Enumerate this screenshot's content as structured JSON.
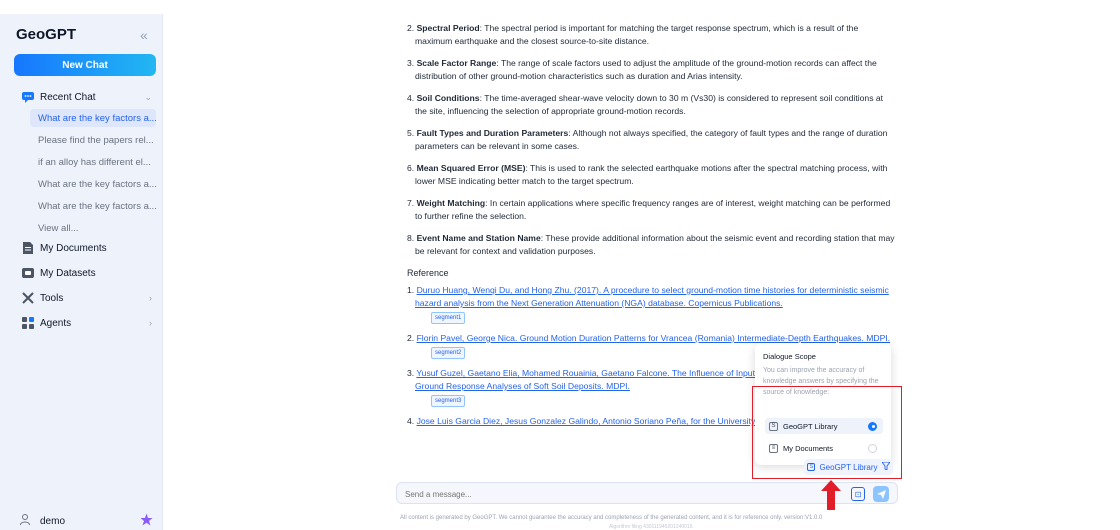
{
  "app": {
    "name": "GeoGPT"
  },
  "sidebar": {
    "new_chat": "New Chat",
    "recent_chat": "Recent Chat",
    "chats": [
      "What are the key factors a...",
      "Please find the papers rel...",
      "if an alloy has different el...",
      "What are the key factors a...",
      "What are the key factors a..."
    ],
    "view_all": "View all...",
    "my_documents": "My Documents",
    "my_datasets": "My Datasets",
    "tools": "Tools",
    "agents": "Agents",
    "user": "demo"
  },
  "answer": {
    "items": [
      {
        "num": "2.",
        "term": "Spectral Period",
        "text": ": The spectral period is important for matching the target response spectrum, which is a result of the maximum earthquake and the closest source-to-site distance."
      },
      {
        "num": "3.",
        "term": "Scale Factor Range",
        "text": ": The range of scale factors used to adjust the amplitude of the ground-motion records can affect the distribution of other ground-motion characteristics such as duration and Arias intensity."
      },
      {
        "num": "4.",
        "term": "Soil Conditions",
        "text": ": The time-averaged shear-wave velocity down to 30 m (Vs30) is considered to represent soil conditions at the site, influencing the selection of appropriate ground-motion records."
      },
      {
        "num": "5.",
        "term": "Fault Types and Duration Parameters",
        "text": ": Although not always specified, the category of fault types and the range of duration parameters can be relevant in some cases."
      },
      {
        "num": "6.",
        "term": "Mean Squared Error (MSE)",
        "text": ": This is used to rank the selected earthquake motions after the spectral matching process, with lower MSE indicating better match to the target spectrum."
      },
      {
        "num": "7.",
        "term": "Weight Matching",
        "text": ": In certain applications where specific frequency ranges are of interest, weight matching can be performed to further refine the selection."
      },
      {
        "num": "8.",
        "term": "Event Name and Station Name",
        "text": ": These provide additional information about the seismic event and recording station that may be relevant for context and validation purposes."
      }
    ],
    "reference_heading": "Reference",
    "references": [
      {
        "num": "1.",
        "text": "Duruo Huang, Wenqi Du, and Hong Zhu. (2017). A procedure to select ground-motion time histories for deterministic seismic hazard analysis from the Next Generation Attenuation (NGA) database. Copernicus Publications.",
        "segment": "segment1"
      },
      {
        "num": "2.",
        "text": "Florin Pavel, George Nica. Ground Motion Duration Patterns for Vrancea (Romania) Intermediate-Depth Earthquakes. MDPI.",
        "segment": "segment2"
      },
      {
        "num": "3.",
        "text": "Yusuf Guzel, Gaetano Elia, Mohamed Rouainia, Gaetano Falcone. The Influence of Input Motion Scaling on Nonlinear Ground Response Analyses of Soft Soil Deposits. MDPI.",
        "segment": "segment3"
      },
      {
        "num": "4.",
        "text": "Jose Luis Garcia Diez, Jesus Gonzalez Galindo, Antonio Soriano Peña, for the University...",
        "segment": ""
      }
    ]
  },
  "scope_popup": {
    "title": "Dialogue Scope",
    "description": "You can improve the accuracy of knowledge answers by specifying the source of knowledge:",
    "options": [
      {
        "label": "GeoGPT Library",
        "selected": true
      },
      {
        "label": "My Documents",
        "selected": false
      }
    ]
  },
  "scope_button": "GeoGPT Library",
  "input": {
    "placeholder": "Send a message..."
  },
  "footer": {
    "disclaimer": "All content is generated by GeoGPT. We cannot guarantee the accuracy and completeness of the generated content, and it is for reference only. version:V1.0.0",
    "record": "Algorithm filing 430111945201240015"
  },
  "colors": {
    "accent": "#1677ff",
    "highlight": "#e11d2a"
  }
}
